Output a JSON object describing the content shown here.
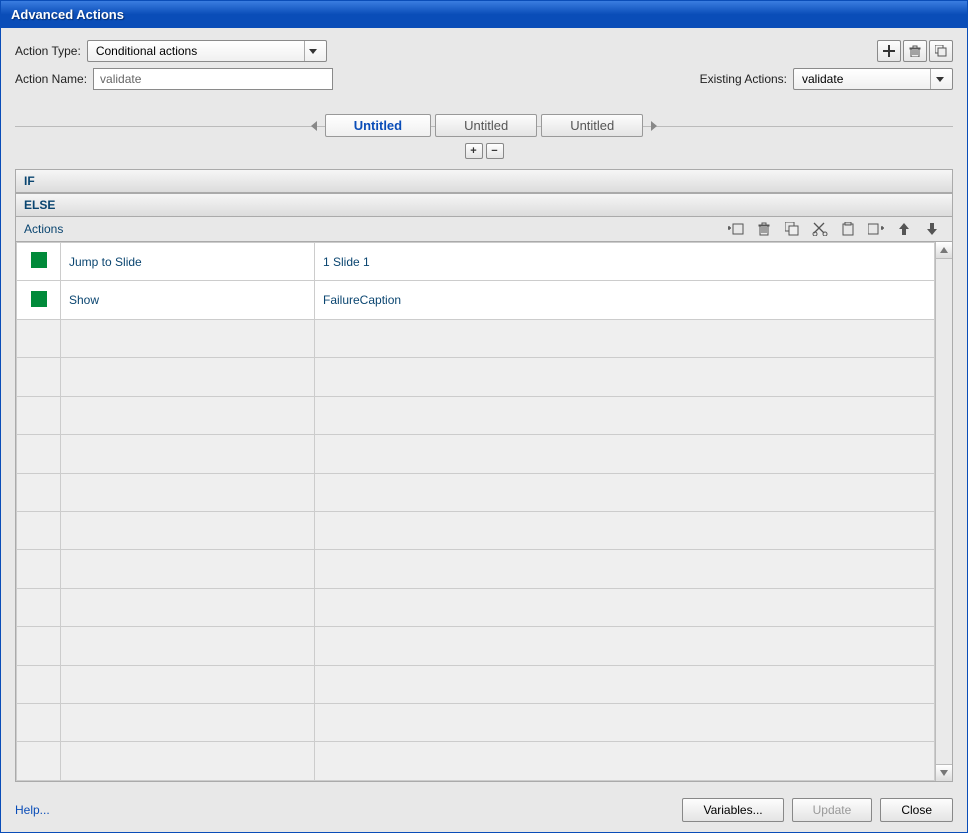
{
  "title": "Advanced Actions",
  "top": {
    "action_type_label": "Action Type:",
    "action_type_value": "Conditional actions",
    "action_name_label": "Action Name:",
    "action_name_value": "validate",
    "existing_actions_label": "Existing Actions:",
    "existing_actions_value": "validate"
  },
  "tabs": [
    {
      "label": "Untitled",
      "active": true
    },
    {
      "label": "Untitled",
      "active": false
    },
    {
      "label": "Untitled",
      "active": false
    }
  ],
  "section_headers": {
    "if": "IF",
    "else": "ELSE",
    "actions": "Actions"
  },
  "actions": [
    {
      "action": "Jump to Slide",
      "param": "1 Slide 1"
    },
    {
      "action": "Show",
      "param": "FailureCaption"
    }
  ],
  "empty_rows": 12,
  "footer": {
    "help": "Help...",
    "variables": "Variables...",
    "update": "Update",
    "close": "Close"
  },
  "plusminus": {
    "plus": "+",
    "minus": "−"
  }
}
